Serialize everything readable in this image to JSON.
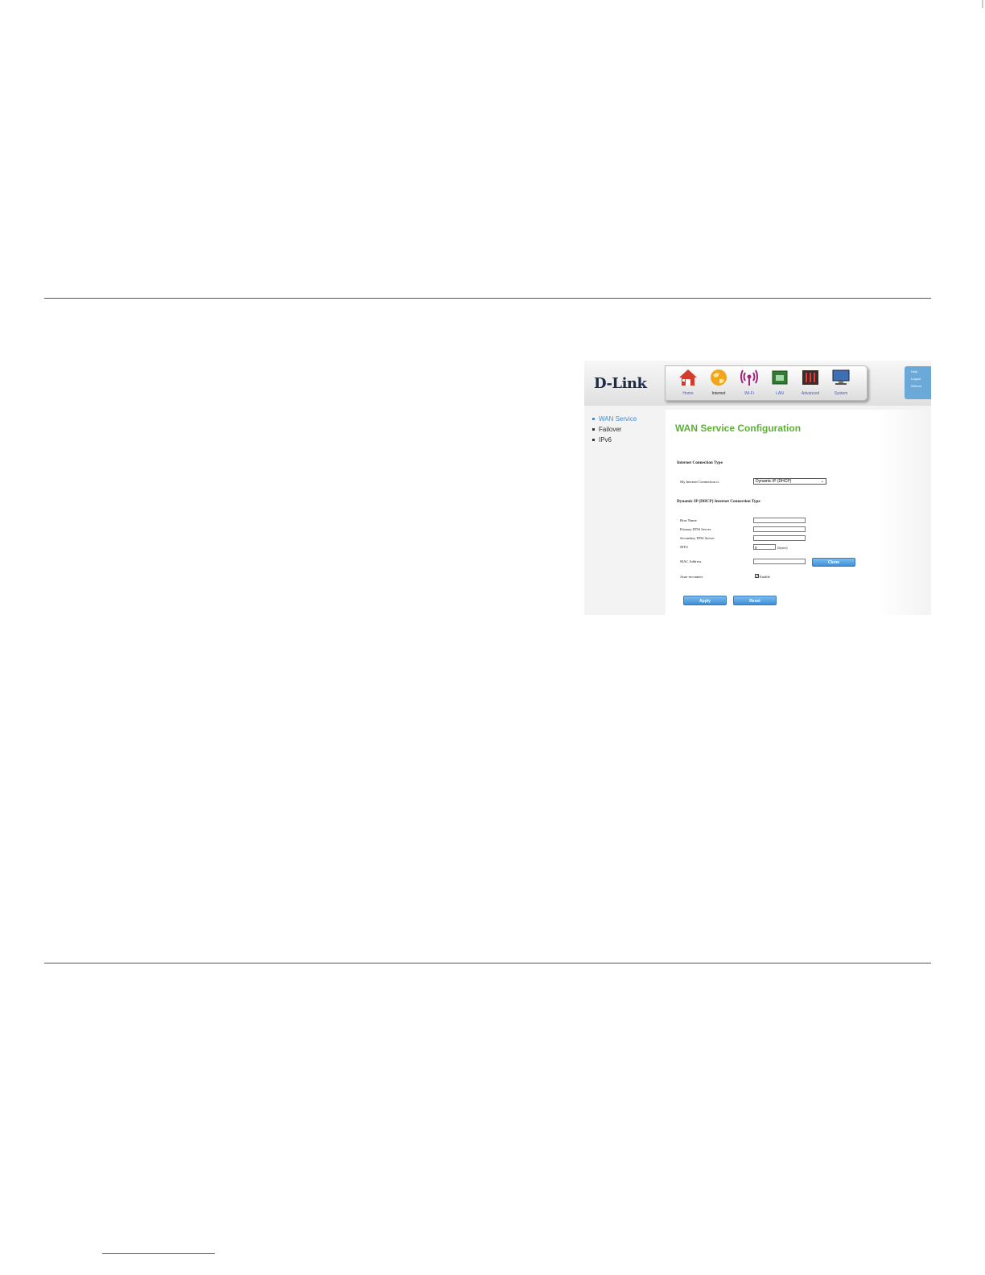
{
  "header": {
    "logo": "D-Link",
    "tabs": [
      {
        "label": "Home",
        "icon": "home-icon"
      },
      {
        "label": "Internet",
        "icon": "globe-icon"
      },
      {
        "label": "Wi-Fi",
        "icon": "wifi-icon"
      },
      {
        "label": "LAN",
        "icon": "lan-icon"
      },
      {
        "label": "Advanced",
        "icon": "advanced-icon"
      },
      {
        "label": "System",
        "icon": "monitor-icon"
      }
    ],
    "active_tab": "Internet",
    "user_menu": [
      "Help",
      "Logout",
      "Reboot"
    ]
  },
  "sidebar": {
    "items": [
      {
        "label": "WAN Service",
        "active": true
      },
      {
        "label": "Failover",
        "active": false
      },
      {
        "label": "IPv6",
        "active": false
      }
    ]
  },
  "main": {
    "title": "WAN Service Configuration",
    "connection_type_heading": "Internet Connection Type",
    "connection_label": "My Internet Connection is",
    "connection_value": "Dynamic IP (DHCP)",
    "dhcp_heading": "Dynamic IP (DHCP) Internet Connection Type",
    "fields": {
      "host_name": {
        "label": "Host Name",
        "value": ""
      },
      "primary_dns": {
        "label": "Primary DNS Server",
        "value": ""
      },
      "secondary_dns": {
        "label": "Secondary DNS Server",
        "value": ""
      },
      "mtu": {
        "label": "MTU",
        "value": "0",
        "unit": "(bytes)"
      },
      "mac": {
        "label": "MAC Address",
        "value": ""
      },
      "auto_reconnect": {
        "label": "Auto-reconnect",
        "checkbox_label": "Enable",
        "checked": true
      }
    },
    "clone_button": "Clone",
    "apply_button": "Apply",
    "reset_button": "Reset"
  },
  "colors": {
    "title_green": "#5cb135",
    "button_blue": "#4a9ae0",
    "sidebar_active": "#3a8ed4"
  }
}
